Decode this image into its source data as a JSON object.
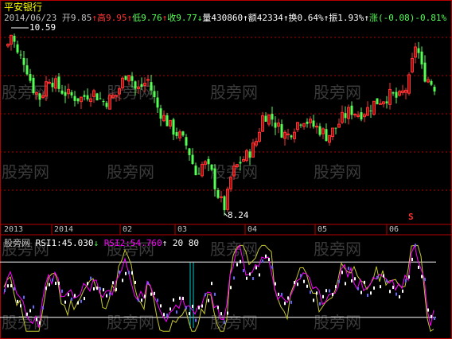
{
  "stock_name": "平安银行",
  "info_line": {
    "date": "2014/06/23",
    "open_label": "开",
    "open": "9.85",
    "high_label": "高",
    "high": "9.95",
    "low_label": "低",
    "low": "9.76",
    "close_label": "收",
    "close": "9.77",
    "volume_label": "量",
    "volume": "430860",
    "amount_label": "额",
    "amount": "42334",
    "turnover_label": "换",
    "turnover": "0.64%",
    "amplitude_label": "振",
    "amplitude": "1.93%",
    "change_label": "涨",
    "change": "(-0.08)",
    "change_pct": "-0.81%"
  },
  "annotations": {
    "high_marker": "10.59",
    "low_marker": "8.24",
    "s_marker": "S"
  },
  "indicator": {
    "name": "RSI",
    "rsi1_label": "RSI1:",
    "rsi1": "45.030",
    "rsi2_label": "RSI2:",
    "rsi2": "54.760",
    "param1": "20",
    "param2": "80"
  },
  "watermark": "股旁网",
  "colors": {
    "up": "#ff3232",
    "down": "#54ff54",
    "grid": "#b40000",
    "rsi1": "#ffffff",
    "rsi2": "#ff00ff",
    "rsi_line3": "#c8c832",
    "hot": "#ffff00"
  },
  "chart_data": {
    "type": "candlestick",
    "time_axis_labels": [
      "2013",
      "2014",
      "02",
      "03",
      "04",
      "05",
      "06"
    ],
    "price_markers": {
      "max": 10.59,
      "min": 8.24
    },
    "candles_approx_count": 140,
    "rsi_thresholds": [
      20,
      80
    ]
  }
}
